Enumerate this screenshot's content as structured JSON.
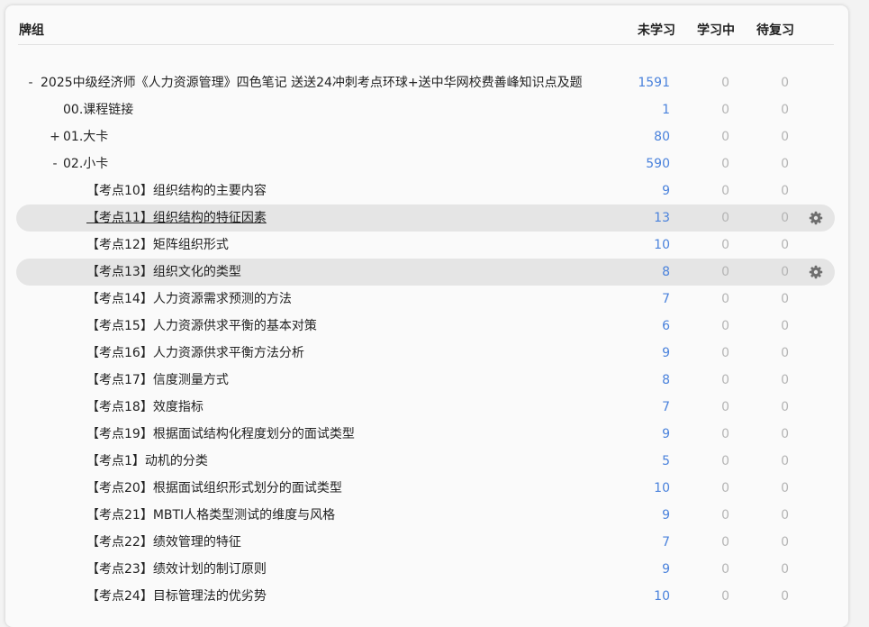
{
  "header": {
    "deck": "牌组",
    "new": "未学习",
    "learning": "学习中",
    "review": "待复习"
  },
  "rows": [
    {
      "toggle": "-",
      "name": "2025中级经济师《人力资源管理》四色笔记 送送24冲刺考点环球+送中华网校费善峰知识点及题",
      "new": "1591",
      "learning": "0",
      "review": "0"
    },
    {
      "toggle": "",
      "name": "00.课程链接",
      "new": "1",
      "learning": "0",
      "review": "0"
    },
    {
      "toggle": "+",
      "name": "01.大卡",
      "new": "80",
      "learning": "0",
      "review": "0"
    },
    {
      "toggle": "-",
      "name": "02.小卡",
      "new": "590",
      "learning": "0",
      "review": "0"
    },
    {
      "toggle": "",
      "name": "【考点10】组织结构的主要内容",
      "new": "9",
      "learning": "0",
      "review": "0"
    },
    {
      "toggle": "",
      "name": "【考点11】组织结构的特征因素",
      "new": "13",
      "learning": "0",
      "review": "0"
    },
    {
      "toggle": "",
      "name": "【考点12】矩阵组织形式",
      "new": "10",
      "learning": "0",
      "review": "0"
    },
    {
      "toggle": "",
      "name": "【考点13】组织文化的类型",
      "new": "8",
      "learning": "0",
      "review": "0"
    },
    {
      "toggle": "",
      "name": "【考点14】人力资源需求预测的方法",
      "new": "7",
      "learning": "0",
      "review": "0"
    },
    {
      "toggle": "",
      "name": "【考点15】人力资源供求平衡的基本对策",
      "new": "6",
      "learning": "0",
      "review": "0"
    },
    {
      "toggle": "",
      "name": "【考点16】人力资源供求平衡方法分析",
      "new": "9",
      "learning": "0",
      "review": "0"
    },
    {
      "toggle": "",
      "name": "【考点17】信度测量方式",
      "new": "8",
      "learning": "0",
      "review": "0"
    },
    {
      "toggle": "",
      "name": "【考点18】效度指标",
      "new": "7",
      "learning": "0",
      "review": "0"
    },
    {
      "toggle": "",
      "name": "【考点19】根据面试结构化程度划分的面试类型",
      "new": "9",
      "learning": "0",
      "review": "0"
    },
    {
      "toggle": "",
      "name": "【考点1】动机的分类",
      "new": "5",
      "learning": "0",
      "review": "0"
    },
    {
      "toggle": "",
      "name": "【考点20】根据面试组织形式划分的面试类型",
      "new": "10",
      "learning": "0",
      "review": "0"
    },
    {
      "toggle": "",
      "name": "【考点21】MBTI人格类型测试的维度与风格",
      "new": "9",
      "learning": "0",
      "review": "0"
    },
    {
      "toggle": "",
      "name": "【考点22】绩效管理的特征",
      "new": "7",
      "learning": "0",
      "review": "0"
    },
    {
      "toggle": "",
      "name": "【考点23】绩效计划的制订原则",
      "new": "9",
      "learning": "0",
      "review": "0"
    },
    {
      "toggle": "",
      "name": "【考点24】目标管理法的优劣势",
      "new": "10",
      "learning": "0",
      "review": "0"
    }
  ]
}
